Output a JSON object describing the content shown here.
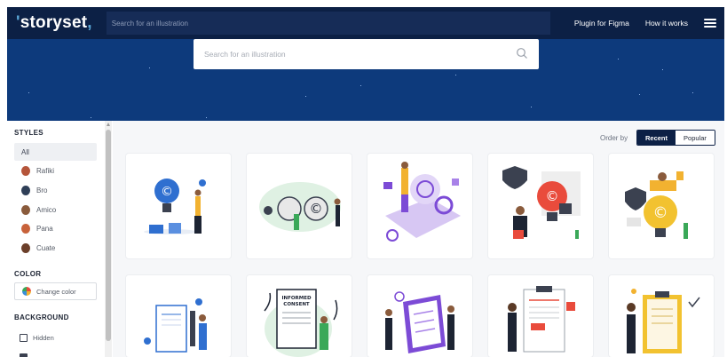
{
  "header": {
    "logo": "storyset",
    "search_placeholder": "Search for an illustration",
    "nav": [
      "Plugin for Figma",
      "How it works"
    ]
  },
  "hero": {
    "search_placeholder": "Search for an illustration"
  },
  "sidebar": {
    "styles_heading": "STYLES",
    "styles": [
      {
        "label": "All",
        "selected": true
      },
      {
        "label": "Rafiki",
        "color": "#b5553a"
      },
      {
        "label": "Bro",
        "color": "#2f3f57"
      },
      {
        "label": "Amico",
        "color": "#8a5b3c"
      },
      {
        "label": "Pana",
        "color": "#c8623a"
      },
      {
        "label": "Cuate",
        "color": "#6b3f2a"
      }
    ],
    "color_heading": "COLOR",
    "change_color": "Change color",
    "background_heading": "BACKGROUND",
    "background_options": [
      "Hidden"
    ]
  },
  "main": {
    "order_by": "Order by",
    "order_options": [
      "Recent",
      "Popular"
    ],
    "selected_order": "Recent"
  },
  "theme": {
    "nav_bg": "#0c2045",
    "hero_bg": "#0d3a7c",
    "accent": "#0c2045"
  }
}
